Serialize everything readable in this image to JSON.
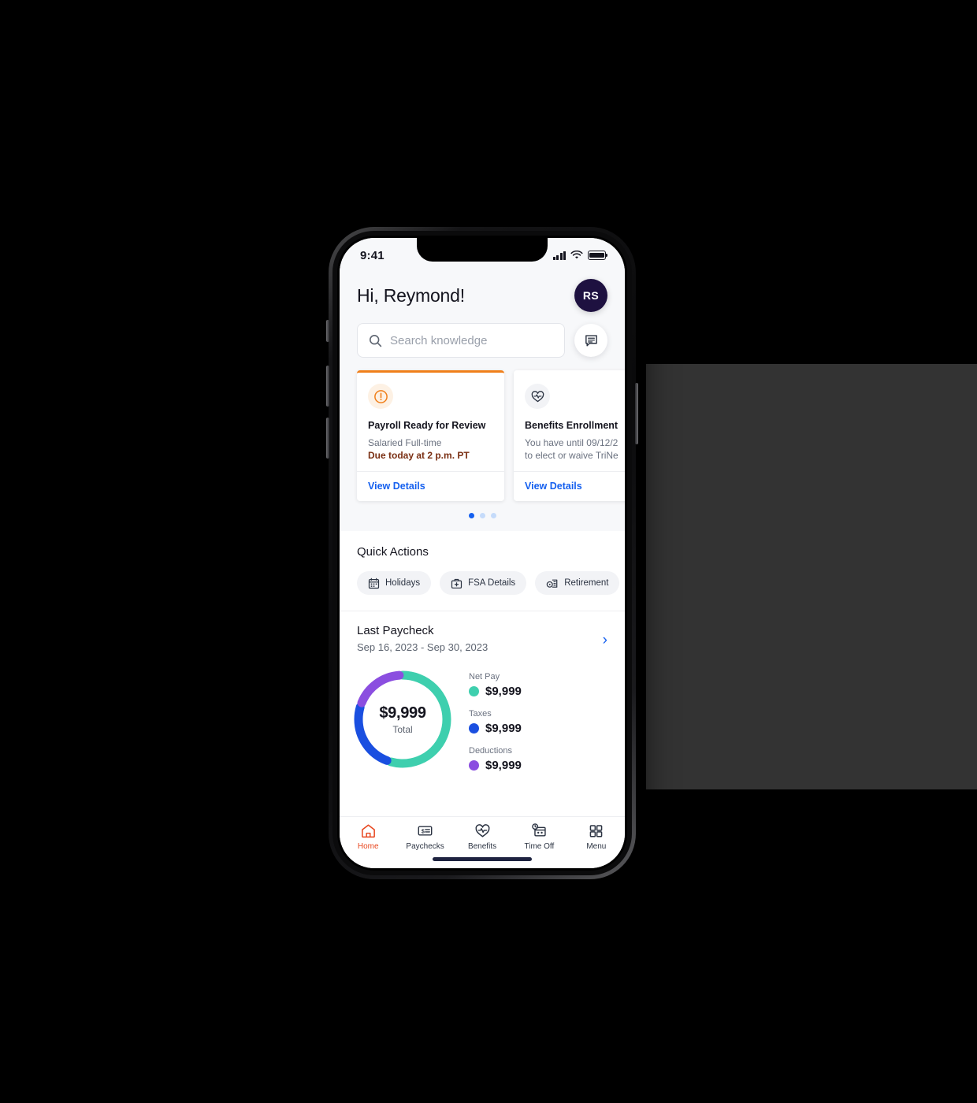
{
  "status_bar": {
    "time": "9:41",
    "signal_icon": "cellular-signal-icon",
    "wifi_icon": "wifi-icon",
    "battery_icon": "battery-icon"
  },
  "header": {
    "greeting": "Hi, Reymond!",
    "avatar_initials": "RS"
  },
  "search": {
    "placeholder": "Search knowledge",
    "icon": "search-icon",
    "chat_button_icon": "chat-bubble-icon"
  },
  "carousel": {
    "cards": [
      {
        "icon": "alert-circle-icon",
        "title": "Payroll Ready for Review",
        "subtitle": "Salaried Full-time",
        "due": "Due today at 2 p.m. PT",
        "link": "View Details",
        "accent_color": "#f07f1a"
      },
      {
        "icon": "heart-pulse-icon",
        "title": "Benefits Enrollment",
        "subtitle_line1": "You have until 09/12/2",
        "subtitle_line2": "to elect or waive TriNe",
        "link": "View Details"
      }
    ],
    "dots": 3,
    "active_dot": 1
  },
  "quick_actions": {
    "heading": "Quick Actions",
    "chips": [
      {
        "label": "Holidays",
        "icon": "calendar-icon"
      },
      {
        "label": "FSA Details",
        "icon": "medical-bag-icon"
      },
      {
        "label": "Retirement",
        "icon": "coins-icon"
      }
    ]
  },
  "last_paycheck": {
    "title": "Last Paycheck",
    "date_range": "Sep 16, 2023 - Sep 30, 2023",
    "chevron_icon": "chevron-right-icon",
    "total_amount": "$9,999",
    "total_label": "Total",
    "legend": [
      {
        "name": "Net Pay",
        "value": "$9,999",
        "color": "#3ecfae"
      },
      {
        "name": "Taxes",
        "value": "$9,999",
        "color": "#1a4fe0"
      },
      {
        "name": "Deductions",
        "value": "$9,999",
        "color": "#8b4ee0"
      }
    ]
  },
  "chart_data": {
    "type": "pie",
    "title": "Last Paycheck",
    "categories": [
      "Net Pay",
      "Taxes",
      "Deductions"
    ],
    "values": [
      55,
      25,
      20
    ],
    "colors": [
      "#3ecfae",
      "#1a4fe0",
      "#8b4ee0"
    ],
    "labels": [
      "$9,999",
      "$9,999",
      "$9,999"
    ],
    "center_text": "$9,999",
    "center_sublabel": "Total",
    "legend_position": "right",
    "donut": true
  },
  "tab_bar": {
    "tabs": [
      {
        "label": "Home",
        "icon": "home-icon",
        "active": true
      },
      {
        "label": "Paychecks",
        "icon": "paycheck-icon",
        "active": false
      },
      {
        "label": "Benefits",
        "icon": "heart-pulse-icon",
        "active": false
      },
      {
        "label": "Time Off",
        "icon": "time-off-icon",
        "active": false
      },
      {
        "label": "Menu",
        "icon": "grid-menu-icon",
        "active": false
      }
    ],
    "active_color": "#e8461e",
    "inactive_color": "#2b3342"
  }
}
